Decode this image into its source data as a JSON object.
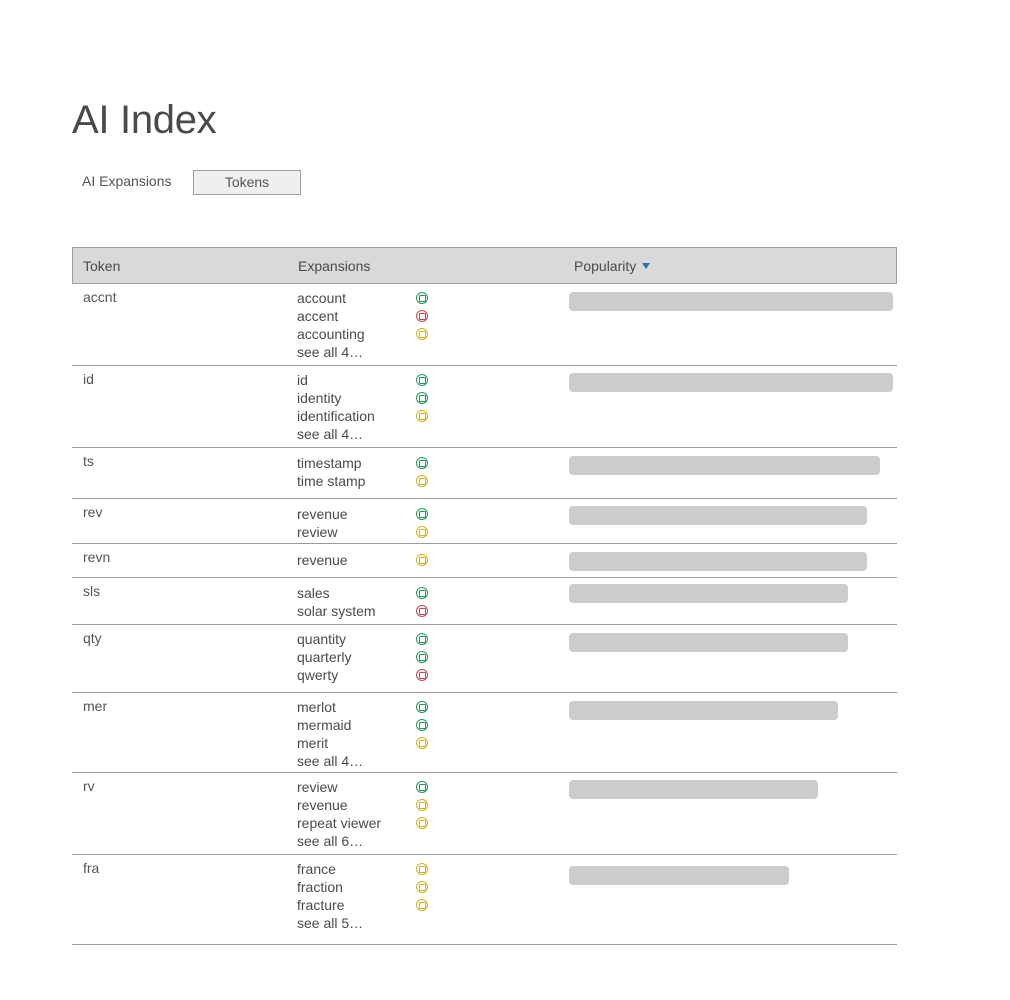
{
  "page": {
    "title": "AI Index"
  },
  "tabs": [
    {
      "label": "AI Expansions",
      "active": false
    },
    {
      "label": "Tokens",
      "active": true
    }
  ],
  "table": {
    "headers": {
      "token": "Token",
      "expansions": "Expansions",
      "popularity": "Popularity"
    },
    "sort": {
      "column": "popularity",
      "direction": "descending"
    },
    "rows": [
      {
        "token": "accnt",
        "popularity": 1.0,
        "expansions": [
          {
            "text": "account",
            "status": "green"
          },
          {
            "text": "accent",
            "status": "red"
          },
          {
            "text": "accounting",
            "status": "yellow"
          }
        ],
        "see_all": "see all 4…"
      },
      {
        "token": "id",
        "popularity": 1.0,
        "expansions": [
          {
            "text": "id",
            "status": "green"
          },
          {
            "text": "identity",
            "status": "green"
          },
          {
            "text": "identification",
            "status": "yellow"
          }
        ],
        "see_all": "see all 4…"
      },
      {
        "token": "ts",
        "popularity": 0.96,
        "expansions": [
          {
            "text": "timestamp",
            "status": "green"
          },
          {
            "text": "time stamp",
            "status": "yellow"
          }
        ],
        "see_all": ""
      },
      {
        "token": "rev",
        "popularity": 0.92,
        "expansions": [
          {
            "text": "revenue",
            "status": "green"
          },
          {
            "text": "review",
            "status": "yellow"
          }
        ],
        "see_all": ""
      },
      {
        "token": "revn",
        "popularity": 0.92,
        "expansions": [
          {
            "text": "revenue",
            "status": "yellow"
          }
        ],
        "see_all": ""
      },
      {
        "token": "sls",
        "popularity": 0.86,
        "expansions": [
          {
            "text": "sales",
            "status": "green"
          },
          {
            "text": "solar system",
            "status": "red"
          }
        ],
        "see_all": ""
      },
      {
        "token": "qty",
        "popularity": 0.86,
        "expansions": [
          {
            "text": "quantity",
            "status": "green"
          },
          {
            "text": "quarterly",
            "status": "green"
          },
          {
            "text": "qwerty",
            "status": "red"
          }
        ],
        "see_all": ""
      },
      {
        "token": "mer",
        "popularity": 0.83,
        "expansions": [
          {
            "text": "merlot",
            "status": "green"
          },
          {
            "text": "mermaid",
            "status": "green"
          },
          {
            "text": "merit",
            "status": "yellow"
          }
        ],
        "see_all": "see all 4…"
      },
      {
        "token": "rv",
        "popularity": 0.77,
        "expansions": [
          {
            "text": "review",
            "status": "green"
          },
          {
            "text": "revenue",
            "status": "yellow"
          },
          {
            "text": "repeat viewer",
            "status": "yellow"
          }
        ],
        "see_all": "see all 6…"
      },
      {
        "token": "fra",
        "popularity": 0.68,
        "expansions": [
          {
            "text": "france",
            "status": "yellow"
          },
          {
            "text": "fraction",
            "status": "yellow"
          },
          {
            "text": "fracture",
            "status": "yellow"
          }
        ],
        "see_all": "see all 5…"
      }
    ]
  }
}
